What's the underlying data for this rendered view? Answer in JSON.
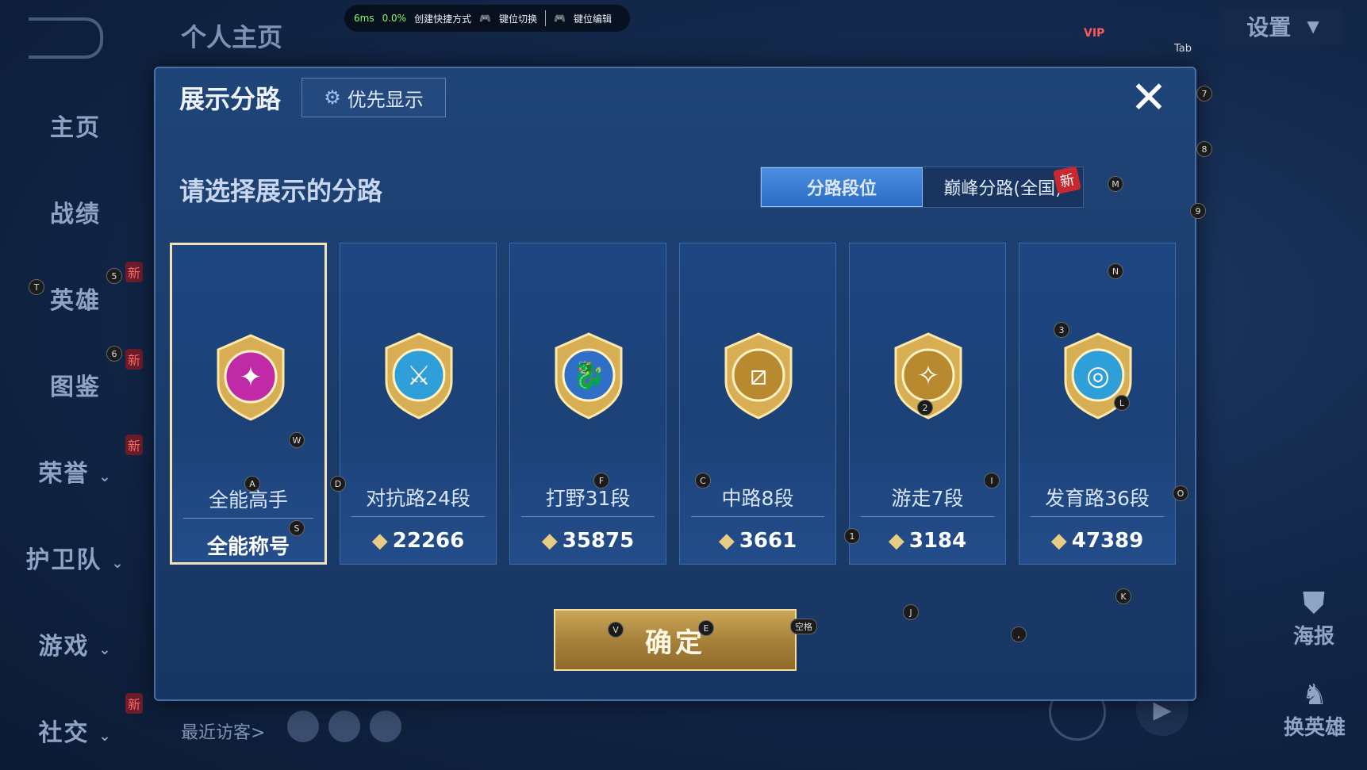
{
  "topbar": {
    "ping": "6ms",
    "loss": "0.0%",
    "create_shortcut": "创建快捷方式",
    "key_switch": "键位切换",
    "key_edit": "键位编辑"
  },
  "header": {
    "personal_home": "个人主页",
    "settings": "设置",
    "vip": "VIP",
    "tab_hint": "Tab"
  },
  "nav": {
    "items": [
      {
        "label": "主页"
      },
      {
        "label": "战绩"
      },
      {
        "label": "英雄",
        "badge": "新"
      },
      {
        "label": "图鉴",
        "badge": "新"
      },
      {
        "label": "荣誉",
        "badge": "新"
      },
      {
        "label": "护卫队"
      },
      {
        "label": "游戏"
      },
      {
        "label": "社交",
        "badge": "新"
      }
    ],
    "recent_visitors": "最近访客>"
  },
  "dialog": {
    "title": "展示分路",
    "priority_button": "优先显示",
    "close": "✕",
    "prompt": "请选择展示的分路",
    "tabs": [
      {
        "label": "分路段位",
        "active": true
      },
      {
        "label": "巅峰分路(全国)",
        "active": false
      }
    ],
    "new_badge": "新",
    "cards": [
      {
        "label": "全能高手",
        "score": "全能称号",
        "color": "#c02aa6",
        "selected": true,
        "has_diamond": false
      },
      {
        "label": "对抗路24段",
        "score": "22266",
        "color": "#2e9fd8",
        "selected": false,
        "has_diamond": true
      },
      {
        "label": "打野31段",
        "score": "35875",
        "color": "#2f6fc8",
        "selected": false,
        "has_diamond": true
      },
      {
        "label": "中路8段",
        "score": "3661",
        "color": "#b8892e",
        "selected": false,
        "has_diamond": true
      },
      {
        "label": "游走7段",
        "score": "3184",
        "color": "#b8892e",
        "selected": false,
        "has_diamond": true
      },
      {
        "label": "发育路36段",
        "score": "47389",
        "color": "#2e9fd8",
        "selected": false,
        "has_diamond": true
      }
    ],
    "confirm": "确定"
  },
  "right": {
    "poster": "海报",
    "switch_hero": "换英雄"
  },
  "key_hints": [
    "T",
    "5",
    "6",
    "W",
    "A",
    "S",
    "D",
    "F",
    "C",
    "1",
    "2",
    "3",
    "7",
    "8",
    "9",
    "M",
    "N",
    "L",
    "O",
    "K",
    "J",
    "V",
    "E",
    "空格",
    ",",
    "I"
  ]
}
